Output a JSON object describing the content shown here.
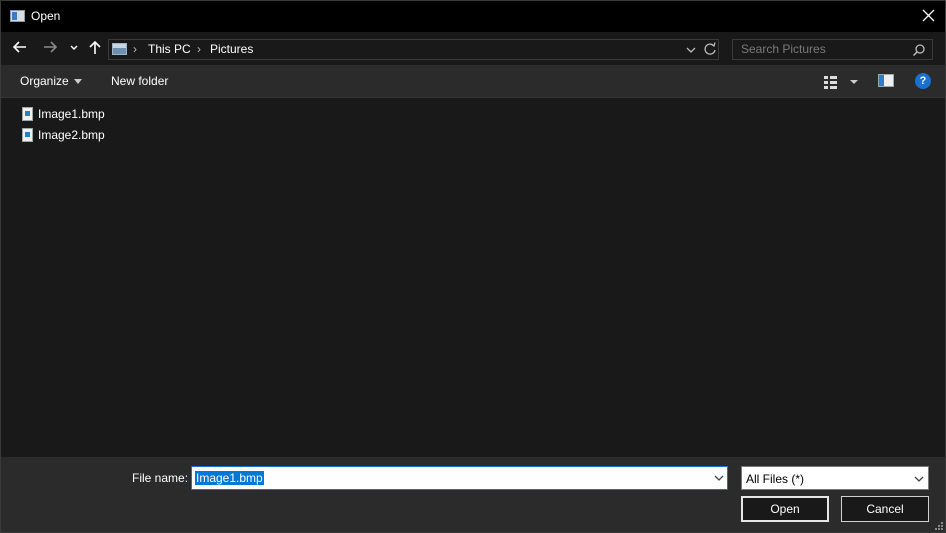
{
  "window": {
    "title": "Open"
  },
  "navigation": {
    "breadcrumb": [
      "This PC",
      "Pictures"
    ],
    "search_placeholder": "Search Pictures"
  },
  "toolbar": {
    "organize_label": "Organize",
    "new_folder_label": "New folder",
    "help_label": "?"
  },
  "files": [
    {
      "name": "Image1.bmp"
    },
    {
      "name": "Image2.bmp"
    }
  ],
  "bottom": {
    "file_name_label": "File name:",
    "file_name_value": "Image1.bmp",
    "file_type_value": "All Files (*)",
    "open_label": "Open",
    "cancel_label": "Cancel"
  },
  "colors": {
    "accent": "#0078d7",
    "background": "#191919",
    "panel": "#2b2b2b"
  }
}
